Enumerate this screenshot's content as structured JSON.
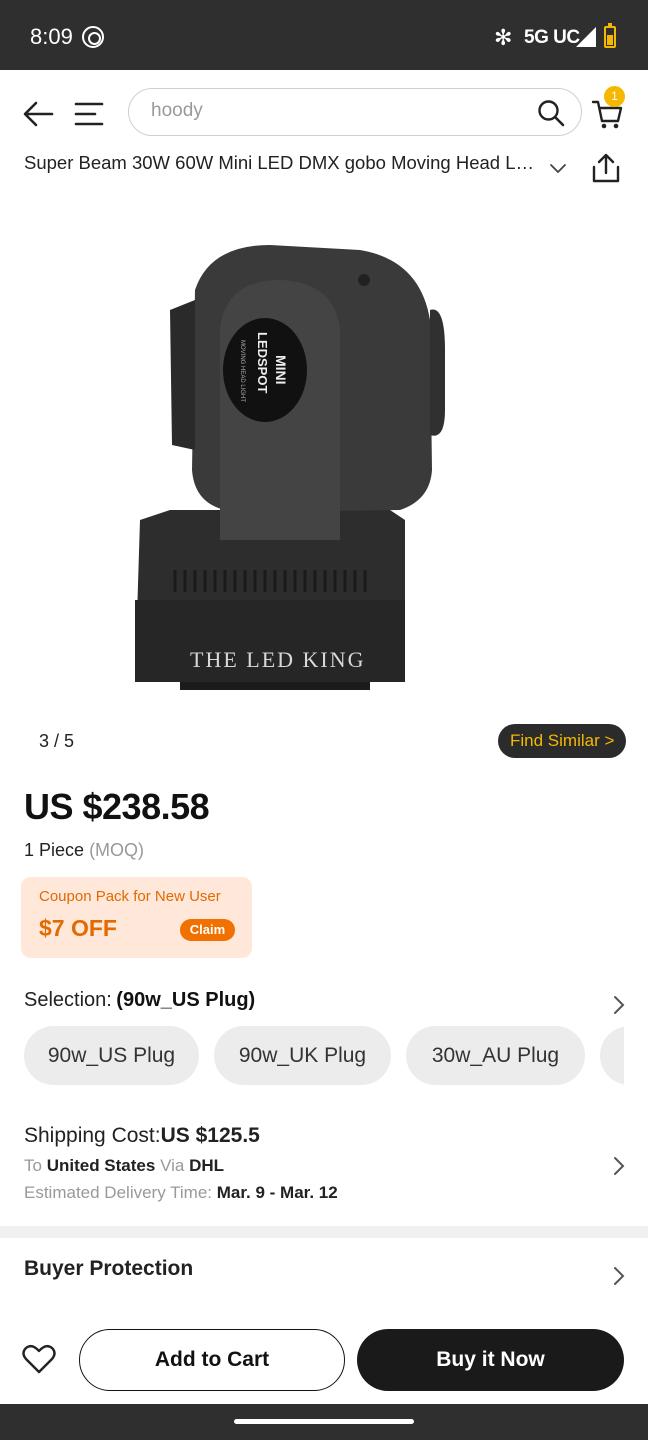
{
  "status_bar": {
    "time": "8:09",
    "network": "5G UC"
  },
  "header": {
    "search_value": "hoody",
    "cart_count": "1"
  },
  "product": {
    "title": "Super Beam 30W 60W Mini LED DMX gobo Moving Head Light",
    "image": {
      "label_line1": "MINI",
      "label_line2": "LEDSPOT",
      "label_line3": "MOVING HEAD LIGHT",
      "watermark": "THE LED KING"
    },
    "image_counter": "3 / 5",
    "find_similar": "Find Similar >",
    "price": "US $238.58",
    "quantity": "1 Piece",
    "moq_note": "(MOQ)"
  },
  "coupon": {
    "label": "Coupon Pack for New User",
    "amount": "$7 OFF",
    "claim": "Claim"
  },
  "selection": {
    "label": "Selection:",
    "value": "(90w_US Plug)",
    "options": [
      "90w_US Plug",
      "90w_UK Plug",
      "30w_AU Plug"
    ]
  },
  "shipping": {
    "cost_label": "Shipping Cost:",
    "cost_value": "US $125.5",
    "to_label": "To",
    "destination": "United States",
    "via_label": "Via",
    "carrier": "DHL",
    "eta_label": "Estimated Delivery Time:",
    "eta_value": "Mar. 9 - Mar. 12"
  },
  "buyer_protection": "Buyer Protection",
  "actions": {
    "add_to_cart": "Add to Cart",
    "buy_now": "Buy it Now"
  },
  "colors": {
    "accent": "#f5b800",
    "coupon_bg": "#ffe7da",
    "coupon_text": "#e26a00",
    "dark": "#1a1a1a"
  }
}
